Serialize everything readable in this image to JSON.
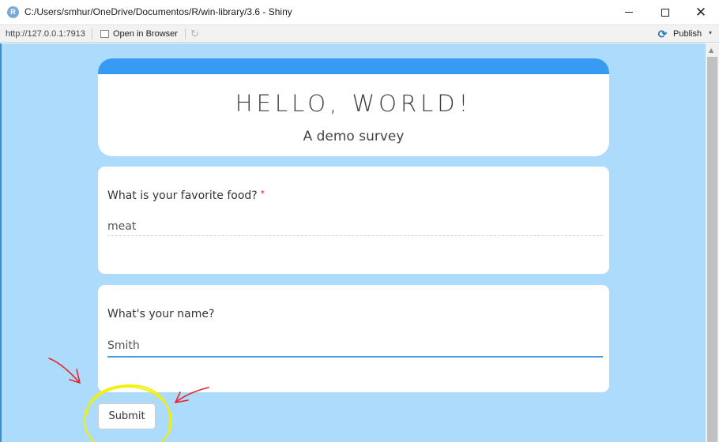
{
  "window": {
    "app_icon": "R",
    "title": "C:/Users/smhur/OneDrive/Documentos/R/win-library/3.6 - Shiny",
    "controls": [
      "minimize-icon",
      "maximize-icon",
      "close-icon"
    ]
  },
  "toolbar": {
    "url": "http://127.0.0.1:7913",
    "open_in_browser": "Open in Browser",
    "publish": "Publish",
    "caret": "▾"
  },
  "survey": {
    "title": "HELLO, WORLD!",
    "subtitle": "A demo survey",
    "accent_color": "#379af3",
    "background_color": "#addbfc"
  },
  "questions": [
    {
      "label": "What is your favorite food?",
      "required_marker": "*",
      "value": "meat"
    },
    {
      "label": "What's your name?",
      "value": "Smith"
    }
  ],
  "submit_label": "Submit",
  "annotation_colors": {
    "arrows": "#e8242b",
    "circle": "#f3f000"
  }
}
